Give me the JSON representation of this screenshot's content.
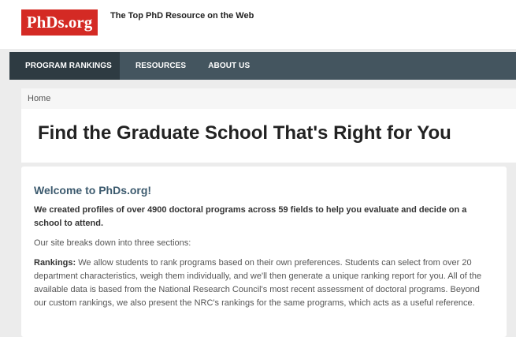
{
  "header": {
    "logo_text": "PhDs.org",
    "tagline": "The Top PhD Resource on the Web"
  },
  "nav": {
    "items": [
      {
        "label": "PROGRAM RANKINGS",
        "active": true
      },
      {
        "label": "RESOURCES",
        "active": false
      },
      {
        "label": "ABOUT US",
        "active": false
      }
    ]
  },
  "breadcrumb": {
    "home": "Home"
  },
  "page": {
    "title": "Find the Graduate School That's Right for You"
  },
  "content": {
    "welcome_heading": "Welcome to PhDs.org!",
    "intro": "We created profiles of over 4900 doctoral programs across 59 fields to help you evaluate and decide on a school to attend.",
    "sections_intro": "Our site breaks down into three sections:",
    "rankings_label": "Rankings:",
    "rankings_text": "We allow students to rank programs based on their own preferences. Students can select from over 20 department characteristics, weigh them individually, and we'll then generate a unique ranking report for you. All of the available data is based from the National Research Council's most recent assessment of doctoral programs. Beyond our custom rankings, we also present the NRC's rankings for the same programs, which acts as a useful reference."
  },
  "colors": {
    "brand_red": "#d42a24",
    "nav_bg": "#44555f",
    "nav_active_bg": "#2e3b42",
    "heading_blue": "#3c5a6e"
  }
}
